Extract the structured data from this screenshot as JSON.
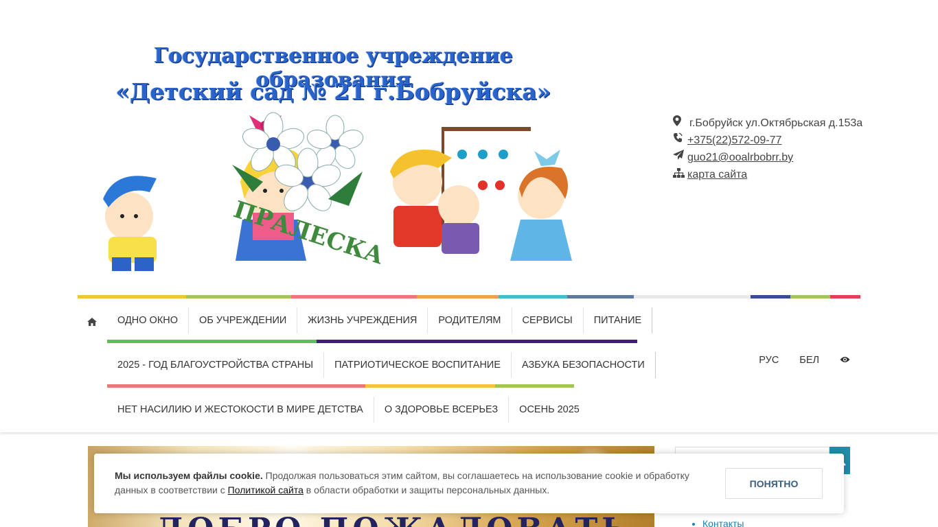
{
  "logo": {
    "line1": "Государственное учреждение образования",
    "line2": "«Детский сад № 21 г.Бобруйска»",
    "emblem_text": "ПРАЛЕСКА"
  },
  "contacts": {
    "address": "г.Бобруйск ул.Октябрьская д.153а",
    "phone": "+375(22)572-09-77",
    "email": "guo21@ooalrbobrr.by",
    "sitemap": "карта сайта"
  },
  "colors": {
    "stripes": [
      "#f5c33b",
      "#a4c35a",
      "#ea7a7a",
      "#f0a050",
      "#4ab8d4",
      "#5b7a9e",
      "#3b4b9b",
      "#a4c35a",
      "#e0405a"
    ],
    "nav_underlines": [
      "#5cbf5c",
      "#3f1f6e",
      "#ea7a7a",
      "#f5c33b",
      "#a4c35a"
    ],
    "search_button": "#1e8fa8"
  },
  "nav": {
    "row1": [
      "ОДНО ОКНО",
      "ОБ УЧРЕЖДЕНИИ",
      "ЖИЗНЬ УЧРЕЖДЕНИЯ",
      "РОДИТЕЛЯМ",
      "СЕРВИСЫ",
      "ПИТАНИЕ"
    ],
    "row2": [
      "2025 - ГОД БЛАГОУСТРОЙСТВА СТРАНЫ",
      "ПАТРИОТИЧЕСКОЕ ВОСПИТАНИЕ",
      "АЗБУКА БЕЗОПАСНОСТИ"
    ],
    "row3": [
      "НЕТ НАСИЛИЮ И ЖЕСТОКОСТИ В МИРЕ ДЕТСТВА",
      "О ЗДОРОВЬЕ ВСЕРЬЕЗ",
      "ОСЕНЬ 2025"
    ],
    "lang_ru": "РУС",
    "lang_be": "БЕЛ"
  },
  "banner": {
    "text": "ДОБРО ПОЖАЛОВАТЬ"
  },
  "sidebar": {
    "link_contacts": "Контакты"
  },
  "cookie": {
    "bold": "Мы используем файлы cookie.",
    "text1": " Продолжая пользоваться этим сайтом, вы соглашаетесь на использование cookie и обработку данных в соответствии с ",
    "link": "Политикой сайта",
    "text2": " в области обработки и защиты персональных данных.",
    "button": "ПОНЯТНО"
  }
}
